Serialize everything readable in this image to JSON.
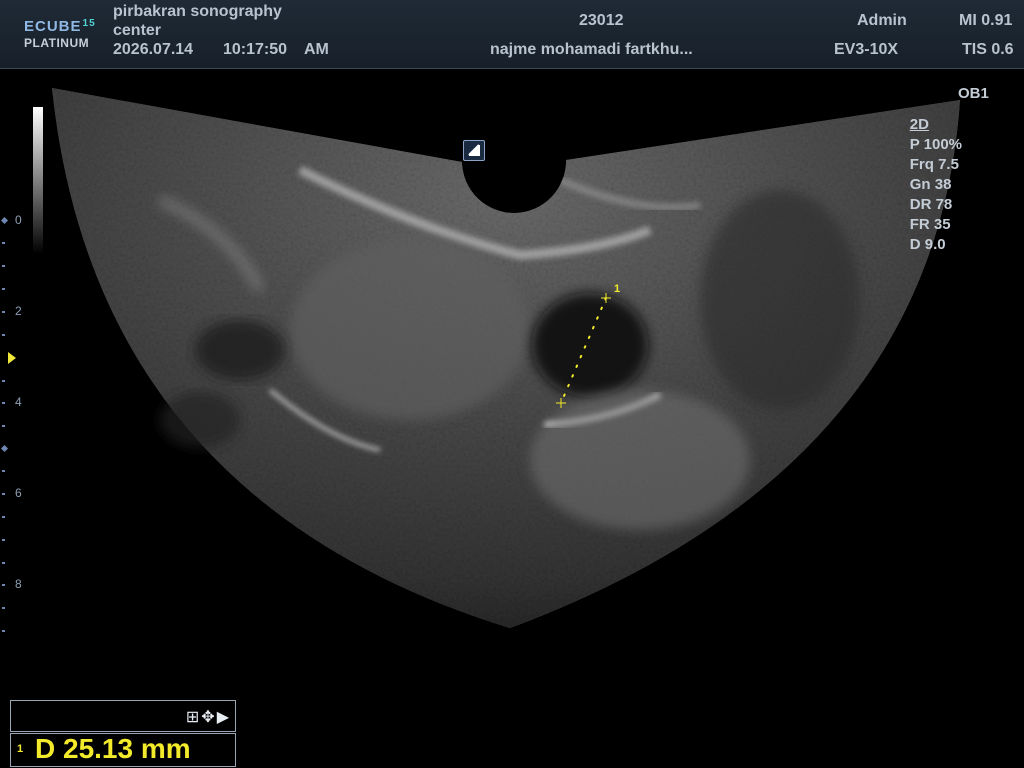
{
  "header": {
    "logo_line1": "ECUBE",
    "logo_number": "15",
    "logo_line2": "PLATINUM",
    "center_name_line1": "pirbakran sonography",
    "center_name_line2": "center",
    "date": "2026.07.14",
    "time": "10:17:50",
    "ampm": "AM",
    "patient_id": "23012",
    "patient_name": "najme mohamadi fartkhu...",
    "user": "Admin",
    "probe": "EV3-10X",
    "mi": "MI 0.91",
    "tis": "TIS 0.6"
  },
  "preset": "OB1",
  "params": {
    "mode": "2D",
    "power": "P 100%",
    "frequency": "Frq 7.5",
    "gain": "Gn 38",
    "dynamic_range": "DR 78",
    "frame_rate": "FR 35",
    "depth": "D 9.0"
  },
  "depth_scale": {
    "labels": [
      "0",
      "2",
      "4",
      "6",
      "8"
    ]
  },
  "measurement": {
    "caliper_label": "1",
    "result_index": "1",
    "result": "D  25.13 mm",
    "toolbar_icons": [
      "grid-icon",
      "move-icon",
      "play-icon"
    ]
  },
  "colors": {
    "caliper": "#f2ea2a",
    "header_bg": "#1f2a36",
    "text": "#b9c3cf"
  }
}
